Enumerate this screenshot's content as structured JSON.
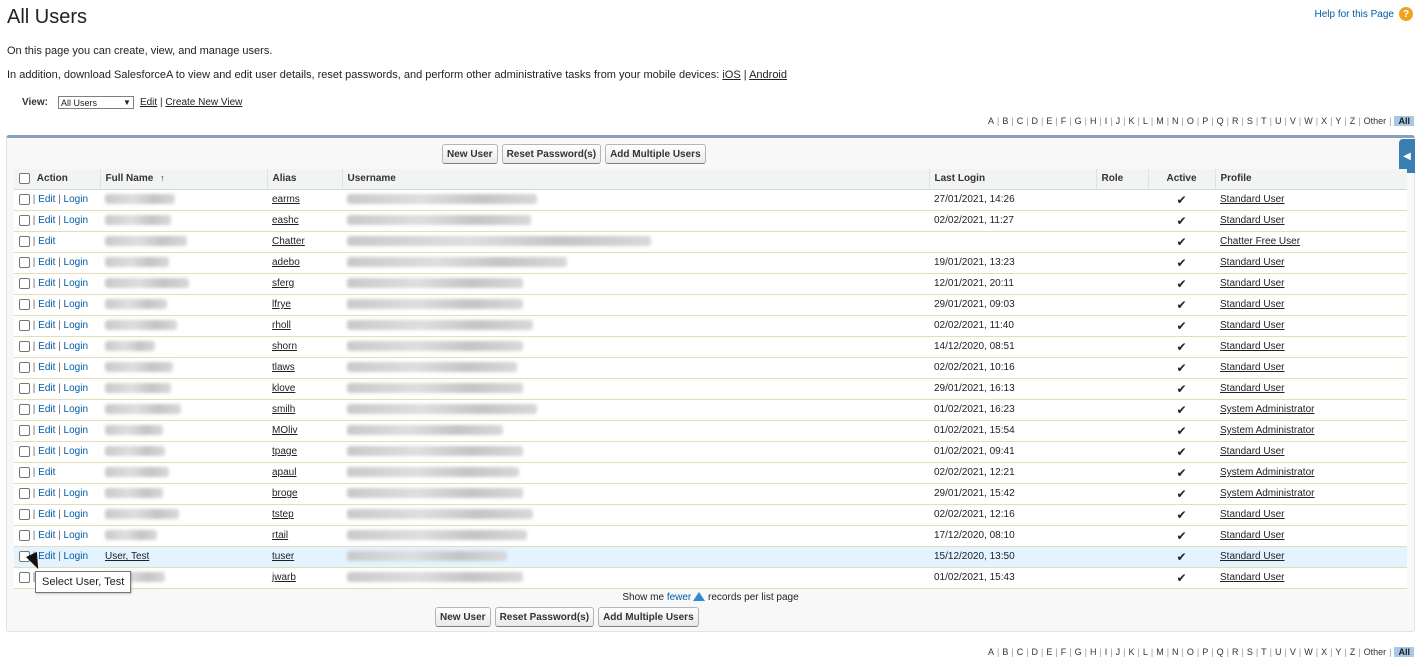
{
  "page": {
    "title": "All Users",
    "help_label": "Help for this Page",
    "intro_text": "On this page you can create, view, and manage users.",
    "mobile_text_prefix": "In addition, download SalesforceA to view and edit user details, reset passwords, and perform other administrative tasks from your mobile devices: ",
    "ios_label": "iOS",
    "separator": " | ",
    "android_label": "Android"
  },
  "view": {
    "label": "View:",
    "selected": "All Users",
    "edit_label": "Edit",
    "create_label": "Create New View"
  },
  "alpha": [
    "A",
    "B",
    "C",
    "D",
    "E",
    "F",
    "G",
    "H",
    "I",
    "J",
    "K",
    "L",
    "M",
    "N",
    "O",
    "P",
    "Q",
    "R",
    "S",
    "T",
    "U",
    "V",
    "W",
    "X",
    "Y",
    "Z",
    "Other",
    "All"
  ],
  "buttons": {
    "new_user": "New User",
    "reset_password": "Reset Password(s)",
    "add_multiple": "Add Multiple Users"
  },
  "table": {
    "headers": {
      "action": "Action",
      "full_name": "Full Name",
      "alias": "Alias",
      "username": "Username",
      "last_login": "Last Login",
      "role": "Role",
      "active": "Active",
      "profile": "Profile"
    },
    "sort_indicator": "↑",
    "action_edit": "Edit",
    "action_login": "Login",
    "rows": [
      {
        "full_name": "",
        "alias": "earms",
        "last_login": "27/01/2021, 14:26",
        "active": "✔",
        "profile": "Standard User",
        "login": true
      },
      {
        "full_name": "",
        "alias": "eashc",
        "last_login": "02/02/2021, 11:27",
        "active": "✔",
        "profile": "Standard User",
        "login": true
      },
      {
        "full_name": "",
        "alias": "Chatter",
        "last_login": "",
        "active": "✔",
        "profile": "Chatter Free User",
        "login": false
      },
      {
        "full_name": "",
        "alias": "adebo",
        "last_login": "19/01/2021, 13:23",
        "active": "✔",
        "profile": "Standard User",
        "login": true
      },
      {
        "full_name": "",
        "alias": "sferg",
        "last_login": "12/01/2021, 20:11",
        "active": "✔",
        "profile": "Standard User",
        "login": true
      },
      {
        "full_name": "",
        "alias": "lfrye",
        "last_login": "29/01/2021, 09:03",
        "active": "✔",
        "profile": "Standard User",
        "login": true
      },
      {
        "full_name": "",
        "alias": "rholl",
        "last_login": "02/02/2021, 11:40",
        "active": "✔",
        "profile": "Standard User",
        "login": true
      },
      {
        "full_name": "",
        "alias": "shorn",
        "last_login": "14/12/2020, 08:51",
        "active": "✔",
        "profile": "Standard User",
        "login": true
      },
      {
        "full_name": "",
        "alias": "tlaws",
        "last_login": "02/02/2021, 10:16",
        "active": "✔",
        "profile": "Standard User",
        "login": true
      },
      {
        "full_name": "",
        "alias": "klove",
        "last_login": "29/01/2021, 16:13",
        "active": "✔",
        "profile": "Standard User",
        "login": true
      },
      {
        "full_name": "",
        "alias": "smilh",
        "last_login": "01/02/2021, 16:23",
        "active": "✔",
        "profile": "System Administrator",
        "login": true
      },
      {
        "full_name": "",
        "alias": "MOliv",
        "last_login": "01/02/2021, 15:54",
        "active": "✔",
        "profile": "System Administrator",
        "login": true
      },
      {
        "full_name": "",
        "alias": "tpage",
        "last_login": "01/02/2021, 09:41",
        "active": "✔",
        "profile": "Standard User",
        "login": true
      },
      {
        "full_name": "",
        "alias": "apaul",
        "last_login": "02/02/2021, 12:21",
        "active": "✔",
        "profile": "System Administrator",
        "login": false
      },
      {
        "full_name": "",
        "alias": "broge",
        "last_login": "29/01/2021, 15:42",
        "active": "✔",
        "profile": "System Administrator",
        "login": true
      },
      {
        "full_name": "",
        "alias": "tstep",
        "last_login": "02/02/2021, 12:16",
        "active": "✔",
        "profile": "Standard User",
        "login": true
      },
      {
        "full_name": "",
        "alias": "rtail",
        "last_login": "17/12/2020, 08:10",
        "active": "✔",
        "profile": "Standard User",
        "login": true
      },
      {
        "full_name": "User, Test",
        "alias": "tuser",
        "last_login": "15/12/2020, 13:50",
        "active": "✔",
        "profile": "Standard User",
        "login": true,
        "highlight": true
      },
      {
        "full_name": "",
        "alias": "jwarb",
        "last_login": "01/02/2021, 15:43",
        "active": "✔",
        "profile": "Standard User",
        "login": false
      }
    ]
  },
  "footer": {
    "show_prefix": "Show me ",
    "fewer_label": "fewer",
    "show_suffix": " records per list page"
  },
  "tooltip": "Select User, Test"
}
